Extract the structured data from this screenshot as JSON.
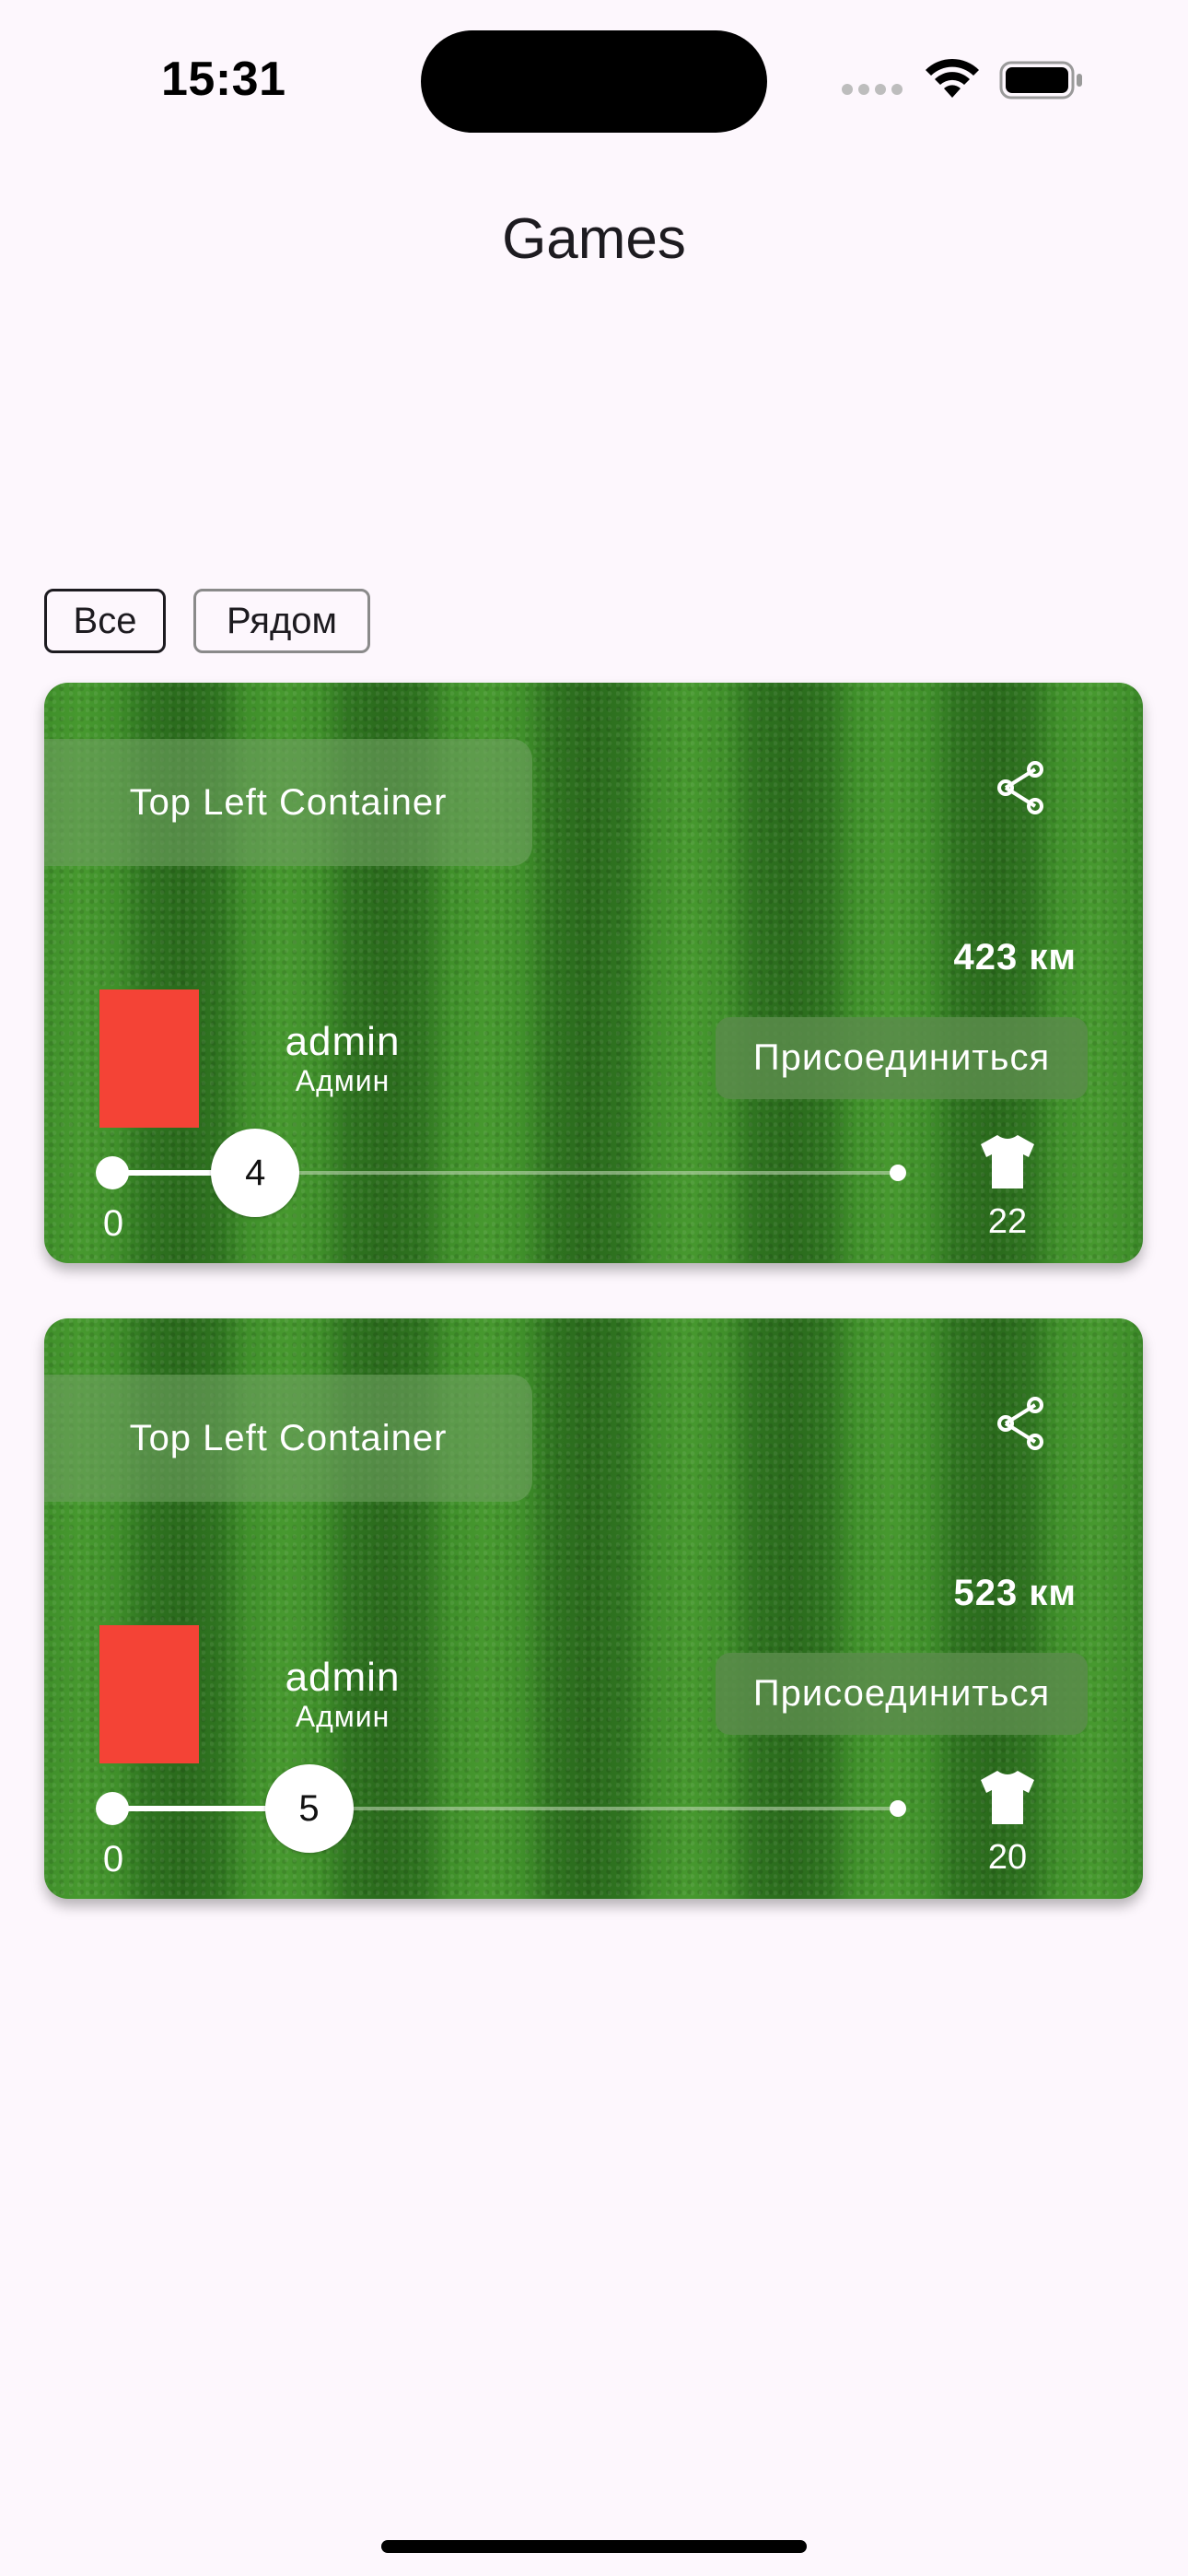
{
  "status_bar": {
    "time": "15:31"
  },
  "header": {
    "title": "Games"
  },
  "filters": {
    "all_label": "Все",
    "nearby_label": "Рядом",
    "selected": "Все"
  },
  "games": [
    {
      "top_left_label": "Top Left Container",
      "distance": "423 км",
      "join_label": "Присоединиться",
      "username": "admin",
      "role": "Админ",
      "slider_min": "0",
      "slider_value": "4",
      "slider_value_num": 4,
      "capacity": "22",
      "capacity_num": 22,
      "avatar_color": "#f44336"
    },
    {
      "top_left_label": "Top Left Container",
      "distance": "523 км",
      "join_label": "Присоединиться",
      "username": "admin",
      "role": "Админ",
      "slider_min": "0",
      "slider_value": "5",
      "slider_value_num": 5,
      "capacity": "20",
      "capacity_num": 20,
      "avatar_color": "#f44336"
    }
  ],
  "icons": {
    "share": "share-icon",
    "shirt": "shirt-icon",
    "wifi": "wifi-icon",
    "battery": "battery-icon"
  },
  "colors": {
    "background": "#fdf7fd",
    "avatar": "#f44336",
    "grass": "#3f8b2b"
  }
}
